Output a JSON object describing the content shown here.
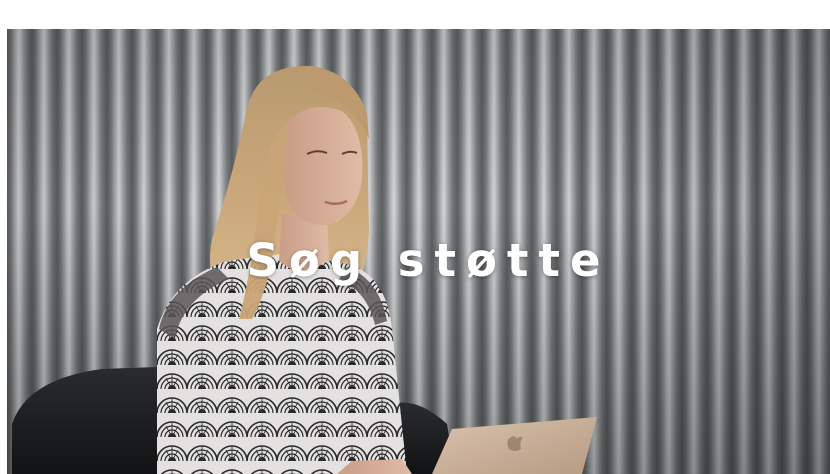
{
  "hero": {
    "title": "Søg støtte",
    "image_description_icon": "woman-with-laptop-photo"
  }
}
